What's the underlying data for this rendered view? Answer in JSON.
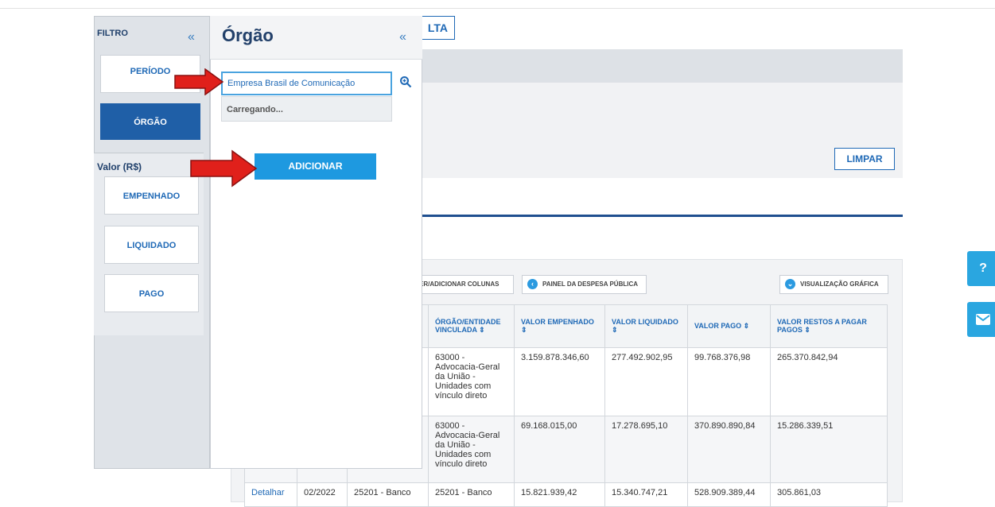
{
  "background": {
    "consulta_fragment": "LTA",
    "limpar_label": "LIMPAR",
    "toolbar": {
      "colunas_label": "ER/ADICIONAR COLUNAS",
      "painel_label": "PAINEL DA DESPESA PÚBLICA",
      "grafica_label": "VISUALIZAÇÃO GRÁFICA"
    },
    "table": {
      "headers": [
        "ÓRGÃO/ENTIDADE VINCULADA ⇕",
        "VALOR EMPENHADO ⇕",
        "VALOR LIQUIDADO ⇕",
        "VALOR PAGO ⇕",
        "VALOR RESTOS A PAGAR PAGOS ⇕"
      ],
      "rows": [
        {
          "detalhar": "",
          "mes": "",
          "orgao": "",
          "entidade": "63000 - Advocacia-Geral da União - Unidades com vínculo direto",
          "empenhado": "3.159.878.346,60",
          "liquidado": "277.492.902,95",
          "pago": "99.768.376,98",
          "restos": "265.370.842,94"
        },
        {
          "detalhar": "",
          "mes": "",
          "orgao": "",
          "entidade": "63000 - Advocacia-Geral da União - Unidades com vínculo direto",
          "empenhado": "69.168.015,00",
          "liquidado": "17.278.695,10",
          "pago": "370.890.890,84",
          "restos": "15.286.339,51"
        },
        {
          "detalhar": "Detalhar",
          "mes": "02/2022",
          "orgao": "25201 - Banco",
          "entidade": "25201 - Banco",
          "empenhado": "15.821.939,42",
          "liquidado": "15.340.747,21",
          "pago": "528.909.389,44",
          "restos": "305.861,03"
        }
      ]
    },
    "help_icon": "question-icon",
    "mail_icon": "envelope-icon"
  },
  "filter": {
    "title": "FILTRO",
    "collapse": "«",
    "periodo": "PERÍODO",
    "orgao": "ÓRGÃO",
    "valor_title": "Valor (R$)",
    "empenhado": "EMPENHADO",
    "liquidado": "LIQUIDADO",
    "pago": "PAGO"
  },
  "orgao_panel": {
    "title": "Órgão",
    "collapse": "«",
    "input_value": "Empresa Brasil de Comunicação",
    "loading": "Carregando...",
    "add_label": "ADICIONAR"
  },
  "colors": {
    "accent": "#1f69b6",
    "active": "#1f5fa7",
    "add_button": "#1e99e0",
    "arrow": "#e0201b"
  }
}
